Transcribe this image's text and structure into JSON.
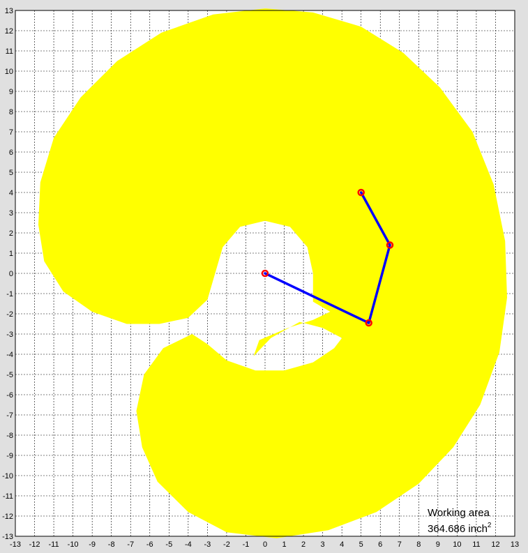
{
  "chart_data": {
    "type": "scatter",
    "title": "",
    "xlabel": "",
    "ylabel": "",
    "xlim": [
      -13,
      13
    ],
    "ylim": [
      -13,
      13
    ],
    "grid": true,
    "grid_style": "dashed",
    "x_ticks": [
      "-13",
      "-12",
      "-11",
      "-10",
      "-9",
      "-8",
      "-7",
      "-6",
      "-5",
      "-4",
      "-3",
      "-2",
      "-1",
      "0",
      "1",
      "2",
      "3",
      "4",
      "5",
      "6",
      "7",
      "8",
      "9",
      "10",
      "11",
      "12",
      "13"
    ],
    "y_ticks": [
      "-13",
      "-12",
      "-11",
      "-10",
      "-9",
      "-8",
      "-7",
      "-6",
      "-5",
      "-4",
      "-3",
      "-2",
      "-1",
      "0",
      "1",
      "2",
      "3",
      "4",
      "5",
      "6",
      "7",
      "8",
      "9",
      "10",
      "11",
      "12",
      "13"
    ],
    "workspace": {
      "color": "#ffff00",
      "outer_boundary": [
        [
          0.0,
          13.1
        ],
        [
          2.5,
          12.9
        ],
        [
          5.0,
          12.2
        ],
        [
          7.2,
          10.9
        ],
        [
          9.1,
          9.2
        ],
        [
          10.8,
          7.0
        ],
        [
          11.9,
          4.4
        ],
        [
          12.5,
          1.6
        ],
        [
          12.6,
          -1.2
        ],
        [
          12.2,
          -3.9
        ],
        [
          11.2,
          -6.5
        ],
        [
          9.8,
          -8.6
        ],
        [
          8.0,
          -10.4
        ],
        [
          5.8,
          -11.8
        ],
        [
          3.3,
          -12.7
        ],
        [
          0.6,
          -13.1
        ],
        [
          -2.0,
          -12.8
        ],
        [
          -4.0,
          -11.8
        ],
        [
          -5.6,
          -10.3
        ],
        [
          -6.4,
          -8.6
        ],
        [
          -6.7,
          -6.8
        ],
        [
          -6.3,
          -5.0
        ],
        [
          -5.3,
          -3.7
        ],
        [
          -3.8,
          -3.0
        ],
        [
          -3.0,
          -3.5
        ],
        [
          -2.0,
          -4.3
        ],
        [
          -0.5,
          -4.8
        ],
        [
          1.0,
          -4.8
        ],
        [
          2.5,
          -4.4
        ],
        [
          3.6,
          -3.7
        ],
        [
          4.0,
          -3.2
        ],
        [
          3.0,
          -2.7
        ],
        [
          1.8,
          -2.4
        ],
        [
          0.3,
          -3.2
        ],
        [
          -0.6,
          -4.1
        ],
        [
          -0.3,
          -3.3
        ],
        [
          1.2,
          -2.7
        ],
        [
          2.5,
          -2.3
        ],
        [
          3.6,
          -1.8
        ],
        [
          4.4,
          -0.8
        ],
        [
          5.2,
          -1.6
        ],
        [
          5.5,
          -2.2
        ],
        [
          5.2,
          -2.9
        ],
        [
          2.5,
          -1.4
        ],
        [
          2.5,
          0.0
        ],
        [
          2.2,
          1.3
        ],
        [
          1.3,
          2.3
        ],
        [
          0.0,
          2.6
        ],
        [
          -1.3,
          2.3
        ],
        [
          -2.2,
          1.3
        ],
        [
          -2.6,
          0.0
        ],
        [
          -3.0,
          -1.3
        ],
        [
          -4.0,
          -2.2
        ],
        [
          -5.5,
          -2.5
        ],
        [
          -7.2,
          -2.5
        ],
        [
          -9.0,
          -1.9
        ],
        [
          -10.5,
          -0.9
        ],
        [
          -11.5,
          0.6
        ],
        [
          -11.8,
          2.4
        ],
        [
          -11.7,
          4.5
        ],
        [
          -11.0,
          6.7
        ],
        [
          -9.6,
          8.7
        ],
        [
          -7.7,
          10.5
        ],
        [
          -5.4,
          11.9
        ],
        [
          -2.7,
          12.8
        ],
        [
          0.0,
          13.1
        ]
      ]
    },
    "arm_links": {
      "color": "#0000ff",
      "x": [
        0,
        5.4,
        6.5,
        5.0
      ],
      "y": [
        0,
        -2.45,
        1.4,
        4.0
      ]
    },
    "joints": {
      "color": "#ff0000",
      "points": [
        [
          0,
          0
        ],
        [
          5.4,
          -2.45
        ],
        [
          6.5,
          1.4
        ],
        [
          5.0,
          4.0
        ]
      ]
    },
    "annotation": {
      "line1": "Working area",
      "line2_value": "364.686 inch",
      "line2_superscript": "2"
    }
  }
}
